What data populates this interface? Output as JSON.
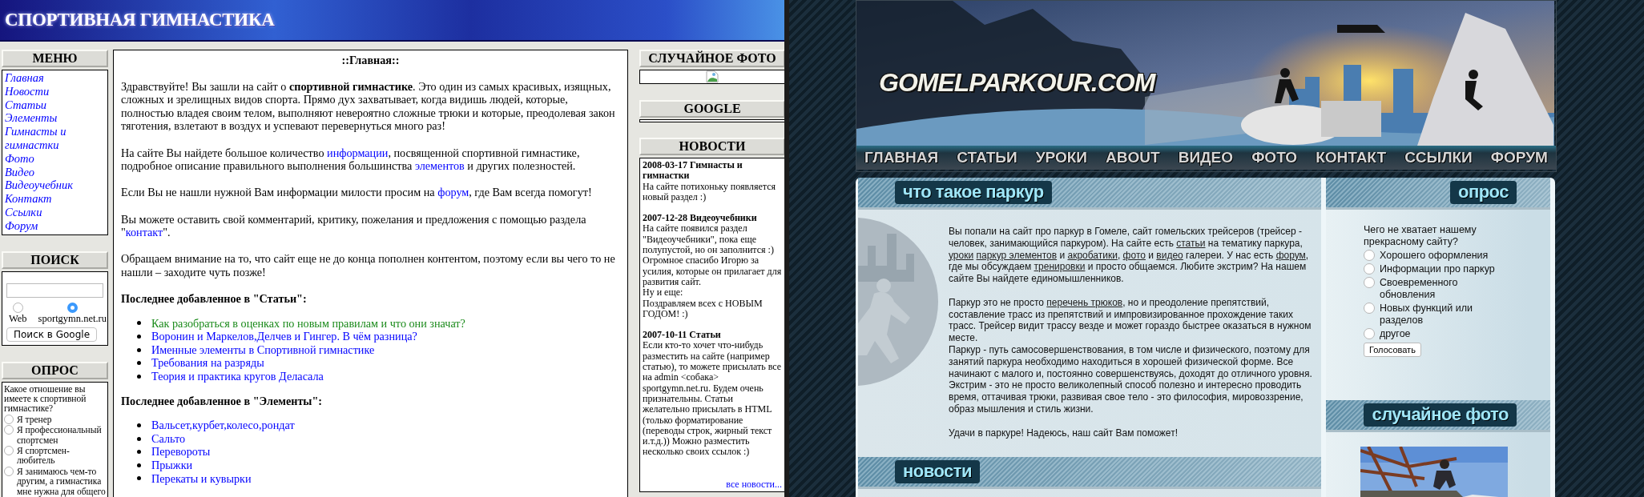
{
  "left_site": {
    "banner": {
      "title": "СПОРТИВНАЯ ГИМНАСТИКА"
    },
    "menu": {
      "title": "МЕНЮ",
      "items": [
        "Главная",
        "Новости",
        "Статьи",
        "Элементы",
        "Гимнасты и гимнастки",
        "Фото",
        "Видео",
        "Видеоучебник",
        "Контакт",
        "Ссылки",
        "Форум"
      ]
    },
    "search": {
      "title": "ПОИСК",
      "options": [
        {
          "label": "Web",
          "selected": false
        },
        {
          "label": "sportgymn.net.ru",
          "selected": true
        }
      ],
      "button": "Поиск в Google"
    },
    "poll": {
      "title": "ОПРОС",
      "question": "Какое отношение вы имеете к спортивной гимнастике?",
      "options": [
        {
          "label": "Я тренер",
          "selected": false
        },
        {
          "label": "Я профессиональный спортсмен",
          "selected": false
        },
        {
          "label": "Я спортсмен-любитель",
          "selected": false
        },
        {
          "label": "Я занимаюсь чем-то другим, а гимнастика мне нужна для общего",
          "selected": false
        }
      ]
    },
    "main": {
      "title": "::Главная::",
      "paragraphs": [
        {
          "parts": [
            {
              "kind": "text",
              "text": "Здравствуйте! Вы зашли на сайт о **спортивной гимнастике**. Это один из самых красивых, изящных, сложных и зрелищных видов спорта. Прямо дух захватывает, когда видишь людей, которые, полностью владея своим телом, выполняют невероятно сложные трюки и которые, преодолевая закон тяготения, взлетают в воздух и успевают перевернуться много раз!"
            }
          ]
        },
        {
          "parts": [
            {
              "kind": "text",
              "text": "На сайте Вы найдете большое количество "
            },
            {
              "kind": "link",
              "text": "информации"
            },
            {
              "kind": "text",
              "text": ", посвященной спортивной гимнастике, подробное описание правильного выполнения большинства "
            },
            {
              "kind": "link",
              "text": "элементов"
            },
            {
              "kind": "text",
              "text": " и других полезностей."
            }
          ]
        },
        {
          "parts": [
            {
              "kind": "text",
              "text": "Если Вы не нашли нужной Вам информации милости просим на "
            },
            {
              "kind": "link",
              "text": "форум"
            },
            {
              "kind": "text",
              "text": ", где Вам всегда помогут!"
            }
          ]
        },
        {
          "parts": [
            {
              "kind": "text",
              "text": "Вы можете оставить свой комментарий, критику, пожелания и предложения с помощью раздела \""
            },
            {
              "kind": "link",
              "text": "контакт"
            },
            {
              "kind": "text",
              "text": "\"."
            }
          ]
        },
        {
          "parts": [
            {
              "kind": "text",
              "text": "Обращаем внимание на то, что сайт еще не до конца пополнен контентом, поэтому если вы чего то не нашли – заходите чуть позже!"
            }
          ]
        }
      ],
      "sections": [
        {
          "heading": "Последнее добавленное в \"Статьи\":",
          "items": [
            {
              "text": "Как разобраться в оценках по новым правилам и что они значат?",
              "visited": true
            },
            {
              "text": "Воронин и Маркелов,Делчев и Гингер. В чём разница?",
              "visited": false
            },
            {
              "text": "Именные элементы в Спортивной гимнастике",
              "visited": false
            },
            {
              "text": "Требования на разряды",
              "visited": false
            },
            {
              "text": "Теория и практика кругов Деласала",
              "visited": false
            }
          ]
        },
        {
          "heading": "Последнее добавленное в \"Элементы\":",
          "items": [
            {
              "text": "Вальсет,курбет,колесо,рондат",
              "visited": false
            },
            {
              "text": "Сальто",
              "visited": false
            },
            {
              "text": "Перевороты",
              "visited": false
            },
            {
              "text": "Прыжки",
              "visited": false
            },
            {
              "text": "Перекаты и кувырки",
              "visited": false
            }
          ]
        }
      ]
    },
    "random_photo": {
      "title": "СЛУЧАЙНОЕ ФОТО"
    },
    "google": {
      "title": "GOOGLE"
    },
    "news": {
      "title": "НОВОСТИ",
      "items": [
        {
          "title": "2008-03-17 Гимнасты и гимнастки",
          "body": "На сайте потихоньку появляется новый раздел :)"
        },
        {
          "title": "2007-12-28 Видеоучебники",
          "body": "На сайте появился раздел \"Видеоучебники\", пока еще полупустой, но он заполнится :)\nОгромное спасибо Игорю за усилия, которые он прилагает для развития сайт.\nНу и еще:\nПоздравляем всех с НОВЫМ ГОДОМ! :)"
        },
        {
          "title": "2007-10-11 Статьи",
          "body": "Если кто-то хочет что-нибудь разместить на сайте (например статью), то можете присылать все на admin <собака> sportgymn.net.ru. Будем очень признательны. Статьи желательно присылать в HTML (только форматирование (переводы строк, жирный текст и.т.д.)) Можно разместить несколько своих ссылок :)"
        }
      ],
      "more": "все новости..."
    }
  },
  "right_site": {
    "logo": "GOMELPARKOUR.COM",
    "nav": [
      "ГЛАВНАЯ",
      "СТАТЬИ",
      "УРОКИ",
      "ABOUT",
      "ВИДЕО",
      "ФОТО",
      "КОНТАКТ",
      "ССЫЛКИ",
      "ФОРУМ"
    ],
    "about": {
      "title": "что такое паркур",
      "paragraphs": [
        {
          "parts": [
            {
              "kind": "text",
              "text": "Вы попали на сайт про паркур в Гомеле, сайт гомельских трейсеров (трейсер - человек, занимающийся паркуром). На сайте есть "
            },
            {
              "kind": "link",
              "text": "статьи"
            },
            {
              "kind": "text",
              "text": " на тематику паркура, "
            },
            {
              "kind": "link",
              "text": "уроки"
            },
            {
              "kind": "link",
              "text": "паркур элементов"
            },
            {
              "kind": "text",
              "text": " и "
            },
            {
              "kind": "link",
              "text": "акробатики"
            },
            {
              "kind": "text",
              "text": ", "
            },
            {
              "kind": "link",
              "text": "фото"
            },
            {
              "kind": "text",
              "text": " и "
            },
            {
              "kind": "link",
              "text": "видео"
            },
            {
              "kind": "text",
              "text": " галереи. У нас есть "
            },
            {
              "kind": "link",
              "text": "форум"
            },
            {
              "kind": "text",
              "text": ", где мы обсуждаем "
            },
            {
              "kind": "link",
              "text": "тренировки"
            },
            {
              "kind": "text",
              "text": " и просто общаемся. Любите экстрим? На нашем сайте Вы найдете единомышленников."
            }
          ]
        },
        {
          "parts": [
            {
              "kind": "text",
              "text": "Паркур это не просто "
            },
            {
              "kind": "link",
              "text": "перечень трюков"
            },
            {
              "kind": "text",
              "text": ", но и преодоление препятствий, составление трасс из препятствий и импровизированное прохождение таких трасс. Трейсер видит трассу везде и может гораздо быстрее оказаться в нужном месте.\nПаркур - путь самосовершенствования, в том числе и физического, поэтому для занятий паркура необходимо находиться в хорошей физической форме. Все начинают с малого и, постоянно совершенствуясь, доходят до отличного уровня.\nЭкстрим - это не просто великолепный способ полезно и интересно проводить время, оттачивая трюки, развивая свое тело - это философия, мировоззрение, образ мышления и стиль жизни."
            }
          ]
        },
        {
          "parts": [
            {
              "kind": "text",
              "text": "Удачи в паркуре! Надеюсь, наш сайт Вам поможет!"
            }
          ]
        }
      ]
    },
    "news": {
      "title": "новости"
    },
    "poll": {
      "title": "опрос",
      "question": "Чего не хватает нашему прекрасному сайту?",
      "options": [
        {
          "label": "Хорошего оформления",
          "selected": false
        },
        {
          "label": "Информации про паркур",
          "selected": false
        },
        {
          "label": "Своевременного обновления",
          "selected": false
        },
        {
          "label": "Новых функций или разделов",
          "selected": false
        },
        {
          "label": "другое",
          "selected": false
        }
      ],
      "button": "Голосовать"
    },
    "random_photo": {
      "title": "случайное фото"
    }
  }
}
